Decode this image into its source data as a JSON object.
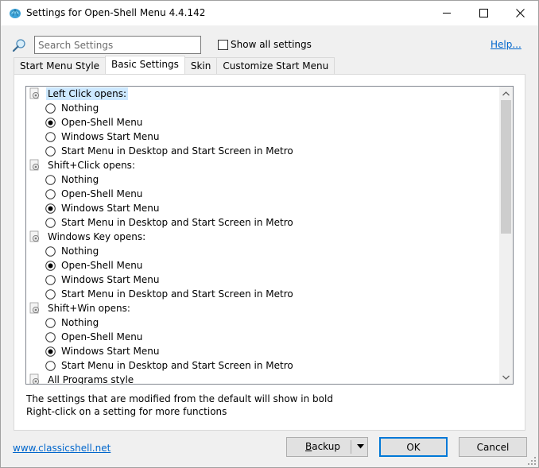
{
  "window": {
    "title": "Settings for Open-Shell Menu 4.4.142",
    "icon": "open-shell-shell-icon",
    "controls": [
      "minimize-icon",
      "maximize-icon",
      "close-icon"
    ]
  },
  "search": {
    "placeholder": "Search Settings",
    "value": ""
  },
  "show_all": {
    "label": "Show all settings",
    "checked": false
  },
  "help": {
    "label": "Help..."
  },
  "tabs": [
    {
      "label": "Start Menu Style",
      "active": false
    },
    {
      "label": "Basic Settings",
      "active": true
    },
    {
      "label": "Skin",
      "active": false
    },
    {
      "label": "Customize Start Menu",
      "active": false
    }
  ],
  "settings": {
    "groups": [
      {
        "label": "Left Click opens:",
        "selected": true,
        "options": [
          {
            "label": "Nothing",
            "checked": false
          },
          {
            "label": "Open-Shell Menu",
            "checked": true
          },
          {
            "label": "Windows Start Menu",
            "checked": false
          },
          {
            "label": "Start Menu in Desktop and Start Screen in Metro",
            "checked": false
          }
        ]
      },
      {
        "label": "Shift+Click opens:",
        "selected": false,
        "options": [
          {
            "label": "Nothing",
            "checked": false
          },
          {
            "label": "Open-Shell Menu",
            "checked": false
          },
          {
            "label": "Windows Start Menu",
            "checked": true
          },
          {
            "label": "Start Menu in Desktop and Start Screen in Metro",
            "checked": false
          }
        ]
      },
      {
        "label": "Windows Key opens:",
        "selected": false,
        "options": [
          {
            "label": "Nothing",
            "checked": false
          },
          {
            "label": "Open-Shell Menu",
            "checked": true
          },
          {
            "label": "Windows Start Menu",
            "checked": false
          },
          {
            "label": "Start Menu in Desktop and Start Screen in Metro",
            "checked": false
          }
        ]
      },
      {
        "label": "Shift+Win opens:",
        "selected": false,
        "options": [
          {
            "label": "Nothing",
            "checked": false
          },
          {
            "label": "Open-Shell Menu",
            "checked": false
          },
          {
            "label": "Windows Start Menu",
            "checked": true
          },
          {
            "label": "Start Menu in Desktop and Start Screen in Metro",
            "checked": false
          }
        ]
      },
      {
        "label": "All Programs style",
        "selected": false,
        "options": []
      }
    ]
  },
  "hints": {
    "line1": "The settings that are modified from the default will show in bold",
    "line2": "Right-click on a setting for more functions"
  },
  "footer": {
    "site_link": "www.classicshell.net",
    "backup_first": "B",
    "backup_rest": "ackup",
    "ok_label": "OK",
    "cancel_label": "Cancel"
  },
  "colors": {
    "link": "#0066cc",
    "selection": "#cce8ff",
    "ok_border": "#0078d7"
  }
}
